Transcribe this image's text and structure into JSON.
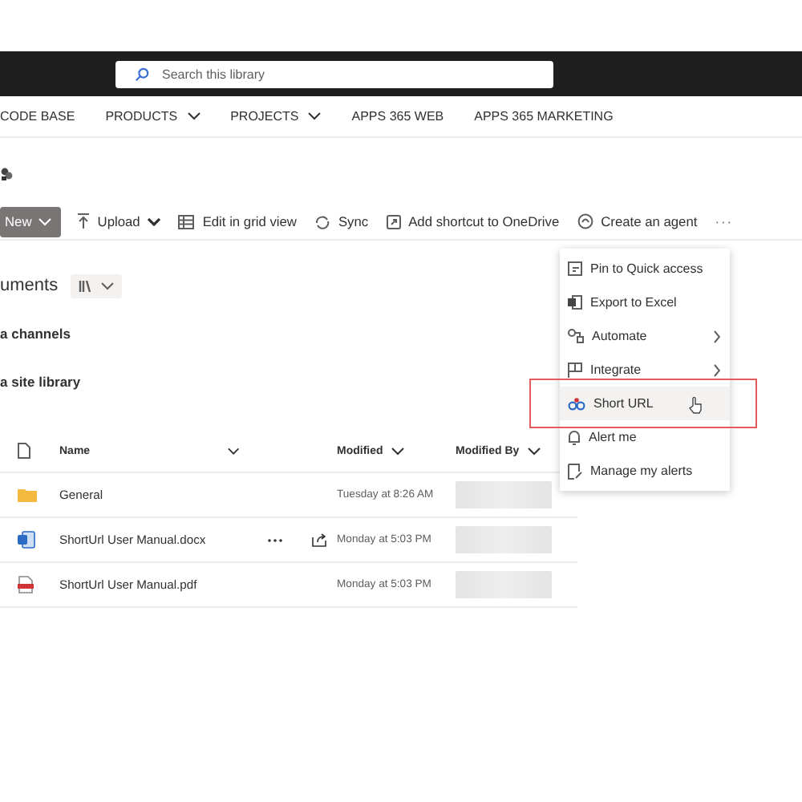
{
  "top_bar": {
    "search": {
      "placeholder": "Search this library"
    }
  },
  "nav": [
    {
      "label": "CODE BASE",
      "dropdown": false
    },
    {
      "label": "PRODUCTS",
      "dropdown": true
    },
    {
      "label": "PROJECTS",
      "dropdown": true
    },
    {
      "label": "APPS 365 WEB",
      "dropdown": false
    },
    {
      "label": "APPS 365 MARKETING",
      "dropdown": false
    }
  ],
  "command_bar": {
    "new_button": "New",
    "commands": [
      {
        "label": "Upload",
        "dropdown": true
      },
      {
        "label": "Edit in grid view",
        "dropdown": false
      },
      {
        "label": "Sync",
        "dropdown": false
      },
      {
        "label": "Add shortcut to OneDrive",
        "dropdown": false
      },
      {
        "label": "Create an agent",
        "dropdown": false
      }
    ],
    "more": "···"
  },
  "library": {
    "title": "uments",
    "links": [
      "a channels",
      "a site library"
    ]
  },
  "table": {
    "columns": [
      "Name",
      "Modified",
      "Modified By"
    ],
    "rows": [
      {
        "kind": "folder",
        "name": "General",
        "modified": "Tuesday at 8:26 AM",
        "hovered": false
      },
      {
        "kind": "word",
        "name": "ShortUrl User Manual.docx",
        "modified": "Monday at 5:03 PM",
        "hovered": true
      },
      {
        "kind": "pdf",
        "name": "ShortUrl User Manual.pdf",
        "modified": "Monday at 5:03 PM",
        "hovered": false
      }
    ]
  },
  "context_menu": {
    "items": [
      {
        "label": "Pin to Quick access",
        "submenu": false,
        "selected": false
      },
      {
        "label": "Export to Excel",
        "submenu": false,
        "selected": false
      },
      {
        "label": "Automate",
        "submenu": true,
        "selected": false
      },
      {
        "label": "Integrate",
        "submenu": true,
        "selected": false
      },
      {
        "label": "Short URL",
        "submenu": false,
        "selected": true
      },
      {
        "label": "Alert me",
        "submenu": false,
        "selected": false
      },
      {
        "label": "Manage my alerts",
        "submenu": false,
        "selected": false
      }
    ]
  }
}
